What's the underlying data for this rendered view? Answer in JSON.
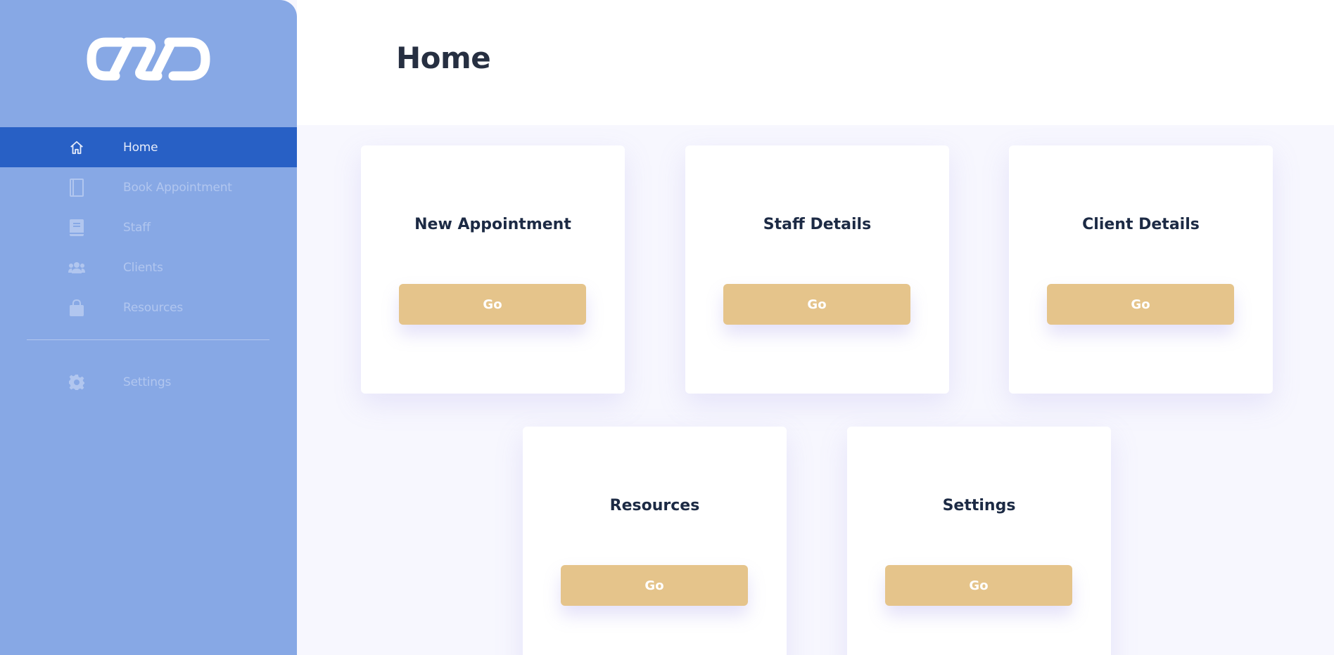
{
  "page": {
    "title": "Home"
  },
  "sidebar": {
    "items": [
      {
        "label": "Home",
        "icon": "home-icon",
        "active": true
      },
      {
        "label": "Book Appointment",
        "icon": "book-icon"
      },
      {
        "label": "Staff",
        "icon": "staff-book-icon"
      },
      {
        "label": "Clients",
        "icon": "users-icon"
      },
      {
        "label": "Resources",
        "icon": "bag-icon"
      }
    ],
    "settings": {
      "label": "Settings",
      "icon": "gear-icon"
    }
  },
  "cards": [
    {
      "title": "New Appointment",
      "button": "Go"
    },
    {
      "title": "Staff Details",
      "button": "Go"
    },
    {
      "title": "Client Details",
      "button": "Go"
    },
    {
      "title": "Resources",
      "button": "Go"
    },
    {
      "title": "Settings",
      "button": "Go"
    }
  ],
  "colors": {
    "sidebar": "#87a8e5",
    "active_item": "#2860c5",
    "button": "#e5c48b",
    "title": "#262f41"
  }
}
